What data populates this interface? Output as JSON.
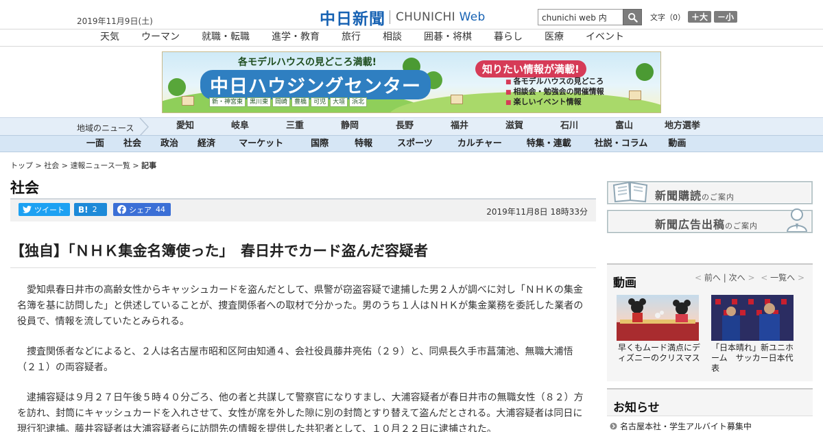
{
  "header": {
    "date": "2019年11月9日(土)",
    "logo_jp": "中日新聞",
    "logo_en_prefix": "CHUNICHI",
    "logo_en_suffix": "Web",
    "search_value": "chunichi web 内",
    "font_size_label": "文字（0）",
    "font_larger": "＋大",
    "font_smaller": "－小"
  },
  "top_nav": [
    "天気",
    "ウーマン",
    "就職・転職",
    "進学・教育",
    "旅行",
    "相談",
    "囲碁・将棋",
    "暮らし",
    "医療",
    "イベント"
  ],
  "banner": {
    "top_text": "各モデルハウスの見どころ満載!",
    "title": "中日ハウジングセンター",
    "areas": [
      "新・神宮東",
      "黒川東",
      "岡崎",
      "豊橋",
      "可児",
      "大垣",
      "浜北"
    ],
    "right_title": "知りたい情報が満載!",
    "right_items": [
      "各モデルハウスの見どころ",
      "相談会・勉強会の開催情報",
      "楽しいイベント情報"
    ]
  },
  "region_bar": {
    "label": "地域のニュース",
    "items": [
      "愛知",
      "岐阜",
      "三重",
      "静岡",
      "長野",
      "福井",
      "滋賀",
      "石川",
      "富山",
      "地方選挙"
    ]
  },
  "category_bar": [
    "一面",
    "社会",
    "政治",
    "経済",
    "マーケット",
    "国際",
    "特報",
    "スポーツ",
    "カルチャー",
    "特集・連載",
    "社説・コラム",
    "動画"
  ],
  "breadcrumb": {
    "items": [
      "トップ",
      "社会",
      "速報ニュース一覧"
    ],
    "current": "記事",
    "separator": " > "
  },
  "section_title": "社会",
  "share": {
    "tweet": "ツイート",
    "hatena_count": "2",
    "facebook_label": "シェア",
    "facebook_count": "44",
    "published": "2019年11月8日 18時33分"
  },
  "article": {
    "headline": "【独自】「ＮＨＫ集金名簿使った」　春日井でカード盗んだ容疑者",
    "paragraphs": [
      "愛知県春日井市の高齢女性からキャッシュカードを盗んだとして、県警が窃盗容疑で逮捕した男２人が調べに対し「ＮＨＫの集金名簿を基に訪問した」と供述していることが、捜査関係者への取材で分かった。男のうち１人はＮＨＫが集金業務を委託した業者の役員で、情報を流していたとみられる。",
      "捜査関係者などによると、２人は名古屋市昭和区阿由知通４、会社役員藤井亮佑（２９）と、同県長久手市菖蒲池、無職大浦悟（２１）の両容疑者。",
      "逮捕容疑は９月２７日午後５時４０分ごろ、他の者と共謀して警察官になりすまし、大浦容疑者が春日井市の無職女性（８２）方を訪れ、封筒にキャッシュカードを入れさせて、女性が席を外した隙に別の封筒とすり替えて盗んだとされる。大浦容疑者は同日に現行犯逮捕。藤井容疑者は大浦容疑者らに訪問先の情報を提供した共犯者として、１０月２２日に逮捕された。"
    ]
  },
  "sidebar": {
    "banner1_main": "新聞購読",
    "banner1_sub": "のご案内",
    "banner2_main": "新聞広告出稿",
    "banner2_sub": "のご案内",
    "video_title": "動画",
    "video_prev": "前へ",
    "video_next": "次へ",
    "video_list": "一覧へ",
    "videos": [
      {
        "caption": "早くもムード満点にディズニーのクリスマス"
      },
      {
        "caption": "「日本晴れ」新ユニホーム　サッカー日本代表"
      }
    ],
    "notice_title": "お知らせ",
    "notice_items": [
      "名古屋本社・学生アルバイト募集中"
    ]
  }
}
